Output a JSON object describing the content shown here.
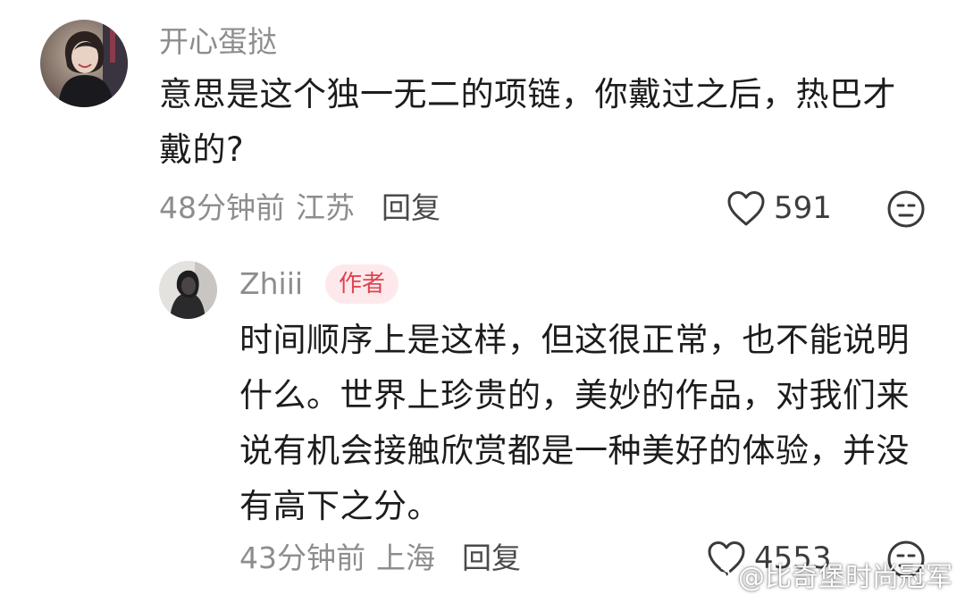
{
  "comments": [
    {
      "username": "开心蛋挞",
      "text": "意思是这个独一无二的项链，你戴过之后，热巴才戴的?",
      "time": "48分钟前",
      "location": "江苏",
      "reply_label": "回复",
      "likes": "591"
    }
  ],
  "reply": {
    "username": "Zhiii",
    "badge": "作者",
    "text": "时间顺序上是这样，但这很正常，也不能说明什么。世界上珍贵的，美妙的作品，对我们来说有机会接触欣赏都是一种美好的体验，并没有高下之分。",
    "time": "43分钟前",
    "location": "上海",
    "reply_label": "回复",
    "likes": "4553"
  },
  "watermark": {
    "text": "@比奇堡时尚冠军"
  },
  "icons": {
    "like": "heart-outline-icon",
    "dislike": "neutral-face-icon",
    "weibo": "weibo-logo-icon"
  },
  "colors": {
    "username": "#8d8d8d",
    "text": "#1c1c1c",
    "badge_bg": "#fde9eb",
    "badge_text": "#e0424f"
  }
}
